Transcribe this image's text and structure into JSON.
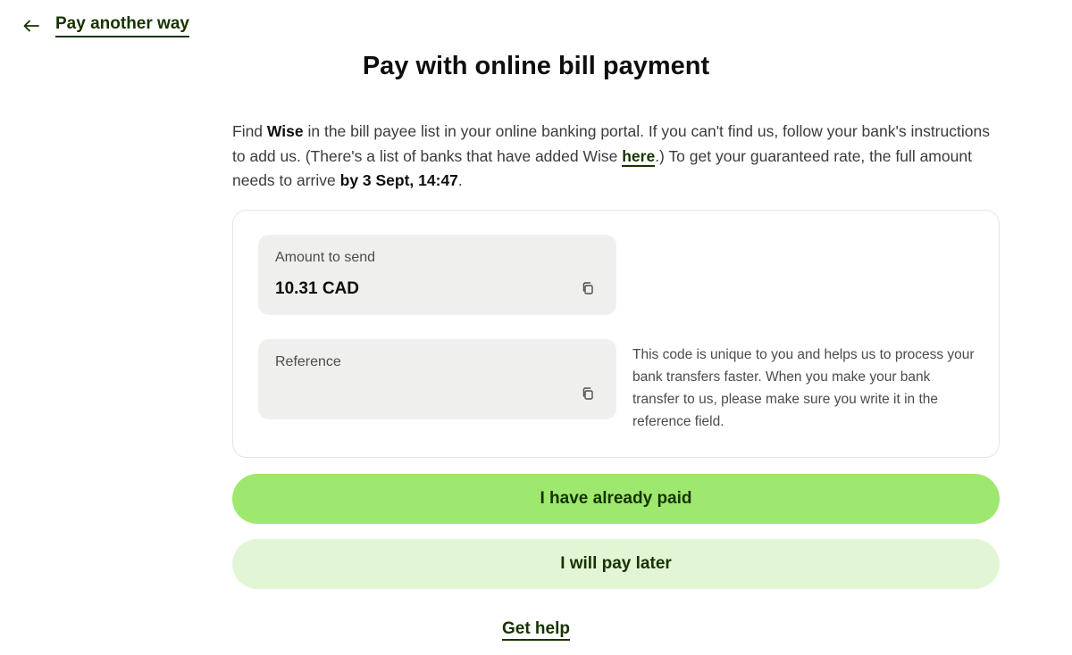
{
  "nav": {
    "back_label": "Pay another way"
  },
  "page": {
    "title": "Pay with online bill payment"
  },
  "intro": {
    "part1": "Find ",
    "payee": "Wise",
    "part2": " in the bill payee list in your online banking portal. If you can't find us, follow your bank's instructions to add us. (There's a list of banks that have added Wise ",
    "link_text": "here",
    "part3": ".) To get your guaranteed rate, the full amount needs to arrive ",
    "deadline": "by 3 Sept, 14:47",
    "part4": "."
  },
  "details": {
    "amount": {
      "label": "Amount to send",
      "value": "10.31 CAD"
    },
    "reference": {
      "label": "Reference",
      "value": "",
      "help": "This code is unique to you and helps us to process your bank transfers faster. When you make your bank transfer to us, please make sure you write it in the reference field."
    }
  },
  "actions": {
    "paid_label": "I have already paid",
    "later_label": "I will pay later",
    "help_label": "Get help"
  },
  "icons": {
    "back": "arrow-left-icon",
    "copy": "copy-icon"
  },
  "colors": {
    "primary_button": "#9fe870",
    "secondary_button": "#e2f6d5",
    "link": "#163300",
    "field_background": "#eff0ee"
  }
}
